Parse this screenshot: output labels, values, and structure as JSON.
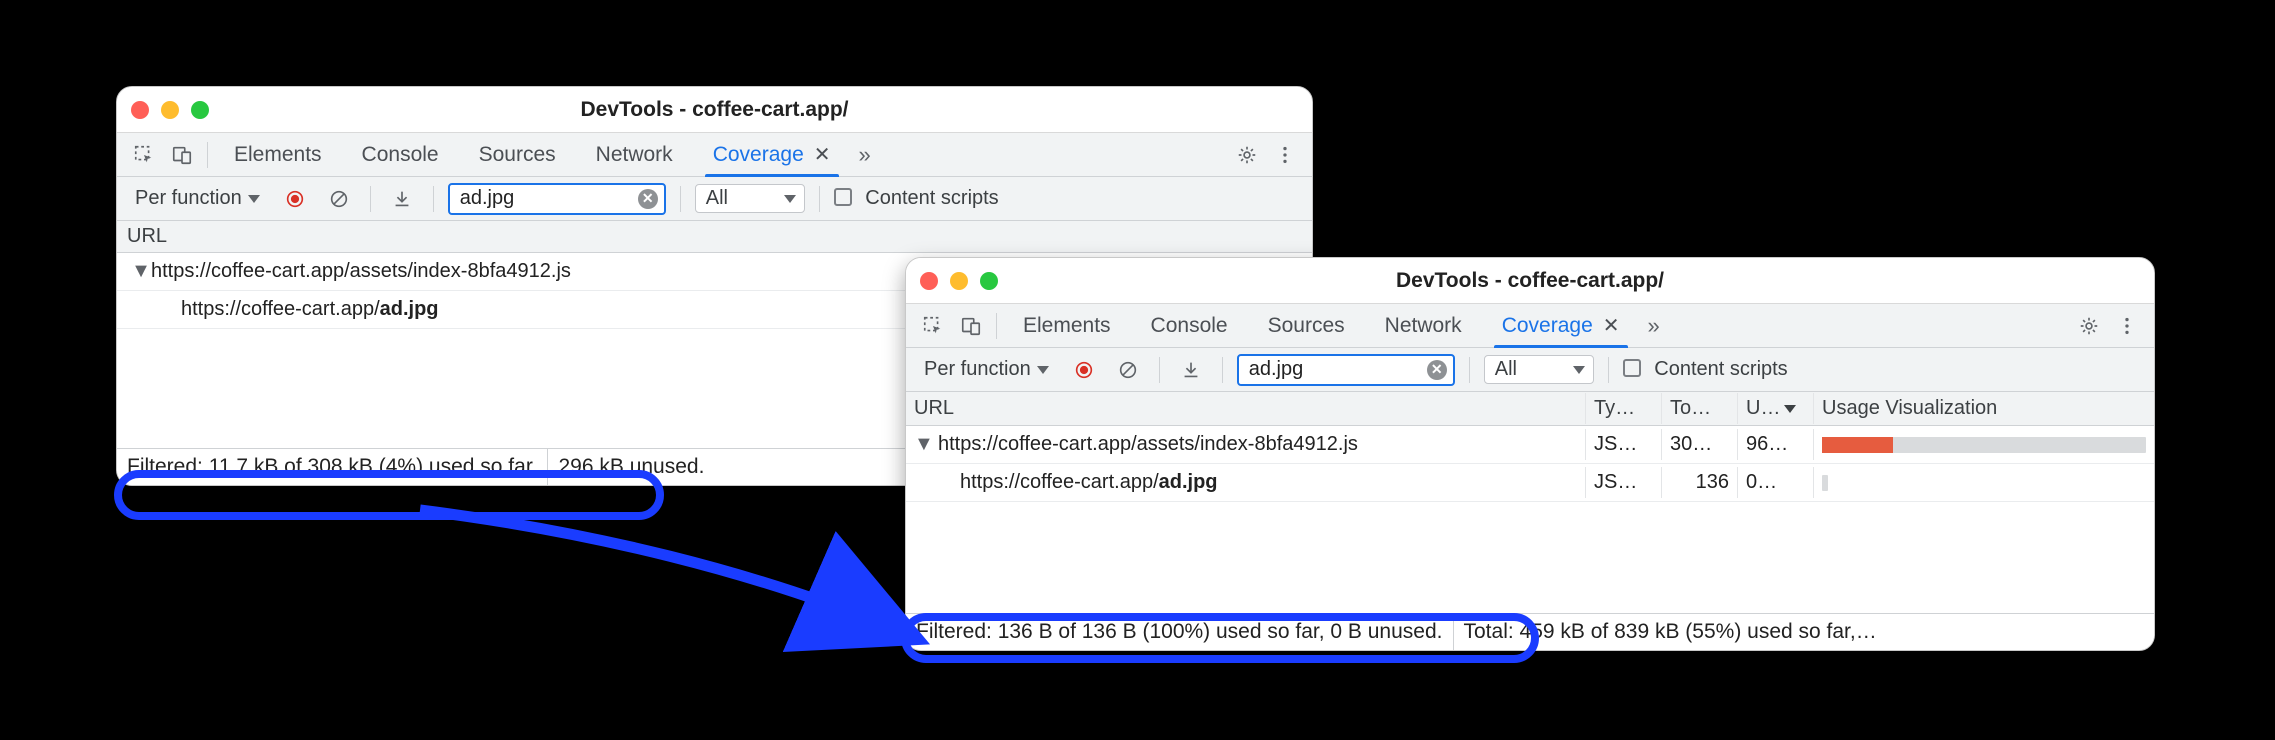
{
  "windows": {
    "a": {
      "title": "DevTools - coffee-cart.app/",
      "tabs": [
        "Elements",
        "Console",
        "Sources",
        "Network",
        "Coverage"
      ],
      "active_tab": "Coverage",
      "toolbar": {
        "granularity": "Per function",
        "filter_value": "ad.jpg",
        "type_filter": "All",
        "content_scripts_label": "Content scripts"
      },
      "url_header": "URL",
      "rows": [
        {
          "url_prefix": "https://coffee-cart.app/assets/index-8bfa4912.js",
          "bold_suffix": "",
          "expandable": true
        },
        {
          "url_prefix": "https://coffee-cart.app/",
          "bold_suffix": "ad.jpg",
          "expandable": false
        }
      ],
      "status": {
        "filtered": "Filtered: 11.7 kB of 308 kB (4%) used so far,",
        "tail": "296 kB unused."
      }
    },
    "b": {
      "title": "DevTools - coffee-cart.app/",
      "tabs": [
        "Elements",
        "Console",
        "Sources",
        "Network",
        "Coverage"
      ],
      "active_tab": "Coverage",
      "toolbar": {
        "granularity": "Per function",
        "filter_value": "ad.jpg",
        "type_filter": "All",
        "content_scripts_label": "Content scripts"
      },
      "columns": {
        "url": "URL",
        "type": "Ty…",
        "total": "To…",
        "unused": "U…",
        "viz": "Usage Visualization"
      },
      "rows": [
        {
          "url_prefix": "https://coffee-cart.app/assets/index-8bfa4912.js",
          "bold_suffix": "",
          "type": "JS…",
          "total": "30…",
          "unused": "96…",
          "used_pct": 22
        },
        {
          "url_prefix": "https://coffee-cart.app/",
          "bold_suffix": "ad.jpg",
          "type": "JS…",
          "total": "136",
          "unused": "0…",
          "used_pct": 0
        }
      ],
      "status": {
        "filtered": "Filtered: 136 B of 136 B (100%) used so far, 0 B unused.",
        "total": "Total: 459 kB of 839 kB (55%) used so far,…"
      }
    }
  }
}
